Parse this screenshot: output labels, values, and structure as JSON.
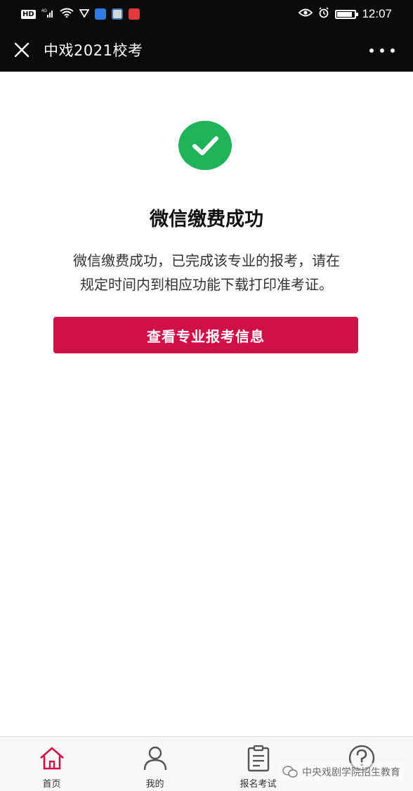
{
  "status_bar": {
    "network_label": "HD",
    "signal_label": "4G",
    "time": "12:07",
    "icons": [
      "hd-icon",
      "signal-icon",
      "wifi-icon",
      "vpn-icon",
      "app-notification-icon",
      "app-notification-icon",
      "app-notification-icon",
      "eye-icon",
      "alarm-icon",
      "battery-icon"
    ]
  },
  "header": {
    "title": "中戏2021校考",
    "close_icon": "close-icon",
    "more_icon": "more-icon"
  },
  "result": {
    "icon": "check-circle-icon",
    "icon_color": "#21b35a",
    "title": "微信缴费成功",
    "description_line1": "微信缴费成功，已完成该专业的报考，请在",
    "description_line2": "规定时间内到相应功能下载打印准考证。",
    "button_label": "查看专业报考信息",
    "button_color": "#cf1147"
  },
  "tab_bar": {
    "tabs": [
      {
        "label": "首页",
        "icon": "home-icon",
        "active": true
      },
      {
        "label": "我的",
        "icon": "user-icon",
        "active": false
      },
      {
        "label": "报名考试",
        "icon": "clipboard-icon",
        "active": false
      },
      {
        "label": "",
        "icon": "help-icon",
        "active": false
      }
    ],
    "active_color": "#cf1147"
  },
  "watermark": {
    "text": "中央戏剧学院招生教育",
    "icon": "wechat-icon"
  }
}
